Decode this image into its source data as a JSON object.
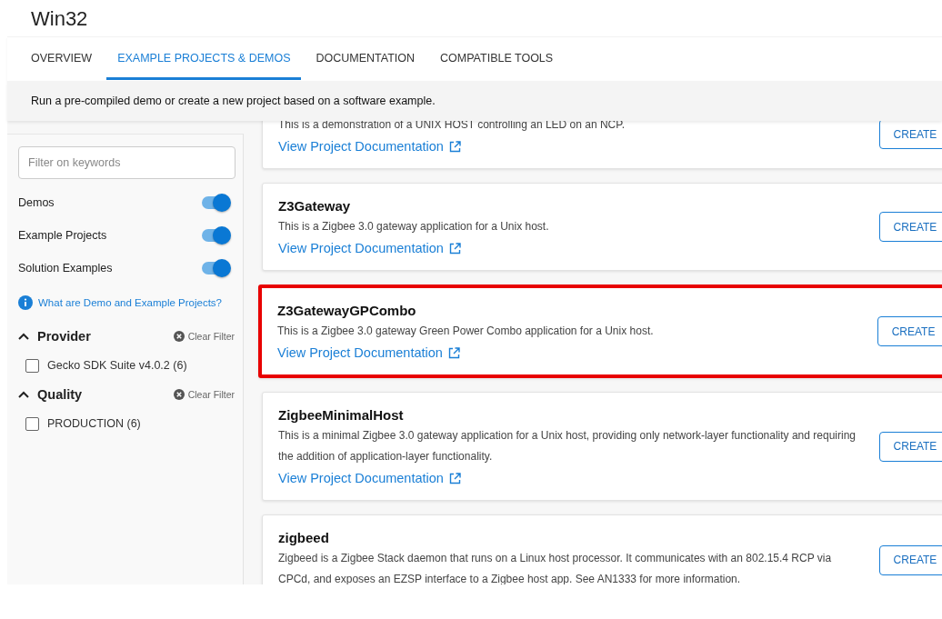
{
  "page_title": "Win32",
  "tabs": [
    {
      "label": "OVERVIEW",
      "selected": false
    },
    {
      "label": "EXAMPLE PROJECTS & DEMOS",
      "selected": true
    },
    {
      "label": "DOCUMENTATION",
      "selected": false
    },
    {
      "label": "COMPATIBLE TOOLS",
      "selected": false
    }
  ],
  "banner": "Run a pre-compiled demo or create a new project based on a software example.",
  "sidebar": {
    "search": {
      "placeholder": "Filter on keywords"
    },
    "toggles": [
      {
        "label": "Demos",
        "on": true
      },
      {
        "label": "Example Projects",
        "on": true
      },
      {
        "label": "Solution Examples",
        "on": true
      }
    ],
    "help_link": "What are Demo and Example Projects?",
    "filters": [
      {
        "title": "Provider",
        "expanded": true,
        "clear": "Clear Filter",
        "options": [
          {
            "label": "Gecko SDK Suite v4.0.2 (6)",
            "checked": false
          }
        ]
      },
      {
        "title": "Quality",
        "expanded": true,
        "clear": "Clear Filter",
        "options": [
          {
            "label": "PRODUCTION (6)",
            "checked": false
          }
        ]
      }
    ]
  },
  "projects": [
    {
      "description": "This is a demonstration of a UNIX HOST controlling an LED on an NCP.",
      "link": "View Project Documentation",
      "button": "CREATE",
      "highlighted": false
    },
    {
      "title": "Z3Gateway",
      "description": "This is a Zigbee 3.0 gateway application for a Unix host.",
      "link": "View Project Documentation",
      "button": "CREATE",
      "highlighted": false
    },
    {
      "title": "Z3GatewayGPCombo",
      "description": "This is a Zigbee 3.0 gateway Green Power Combo application for a Unix host.",
      "link": "View Project Documentation",
      "button": "CREATE",
      "highlighted": true
    },
    {
      "title": "ZigbeeMinimalHost",
      "description": "This is a minimal Zigbee 3.0 gateway application for a Unix host, providing only network-layer functionality and requiring the addition of application-layer functionality.",
      "link": "View Project Documentation",
      "button": "CREATE",
      "highlighted": false
    },
    {
      "title": "zigbeed",
      "description": "Zigbeed is a Zigbee Stack daemon that runs on a Linux host processor. It communicates with an 802.15.4 RCP via CPCd, and exposes an EZSP interface to a Zigbee host app. See AN1333 for more information.",
      "button": "CREATE",
      "highlighted": false
    }
  ]
}
